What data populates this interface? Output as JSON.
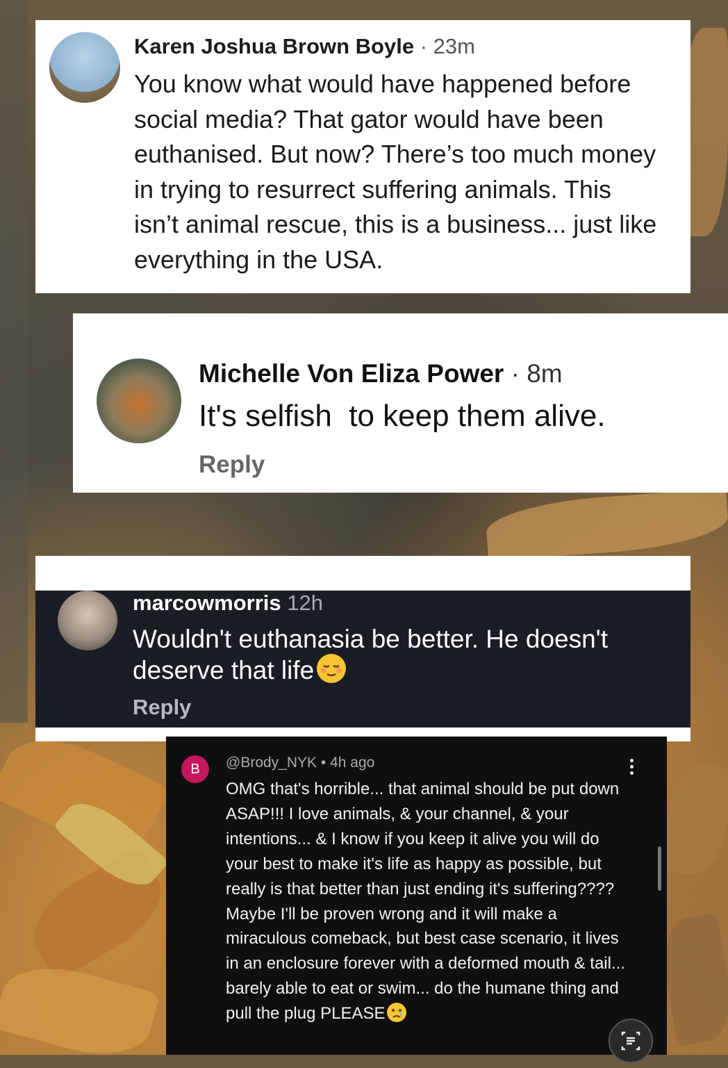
{
  "comments": [
    {
      "author": "Karen Joshua Brown Boyle",
      "separator": " · ",
      "time": "23m",
      "text": "You know what would have happened before\nsocial media? That gator would have been\neuthanised. But now? There’s too much money\nin trying to resurrect suffering animals. This\nisn’t animal rescue, this is a business... just like\neverything in the USA."
    },
    {
      "author": "Michelle Von Eliza Power",
      "separator": " · ",
      "time": "8m",
      "text": "It's selfish  to keep them alive.",
      "reply_label": "Reply"
    },
    {
      "author": "marcowmorris",
      "time": "12h",
      "text": "Wouldn't euthanasia be better. He doesn't deserve that life",
      "emoji": "relieved-face-emoji",
      "reply_label": "Reply"
    },
    {
      "avatar_letter": "B",
      "author": "@Brody_NYK",
      "separator": " • ",
      "time": "4h ago",
      "text": "OMG that's horrible... that animal should be put down ASAP!!! I love animals, & your channel, & your intentions... &  I know if you keep it alive you will do your best to make it's life as happy as possible, but really is that better than just ending it's suffering???? Maybe I'll be proven wrong and it will make a miraculous comeback, but best case scenario, it lives in an enclosure forever with a deformed mouth & tail... barely able to eat or swim... do the humane thing and pull the plug PLEASE",
      "emoji": "crying-face-emoji",
      "avatar_color": "#c5175b"
    }
  ]
}
